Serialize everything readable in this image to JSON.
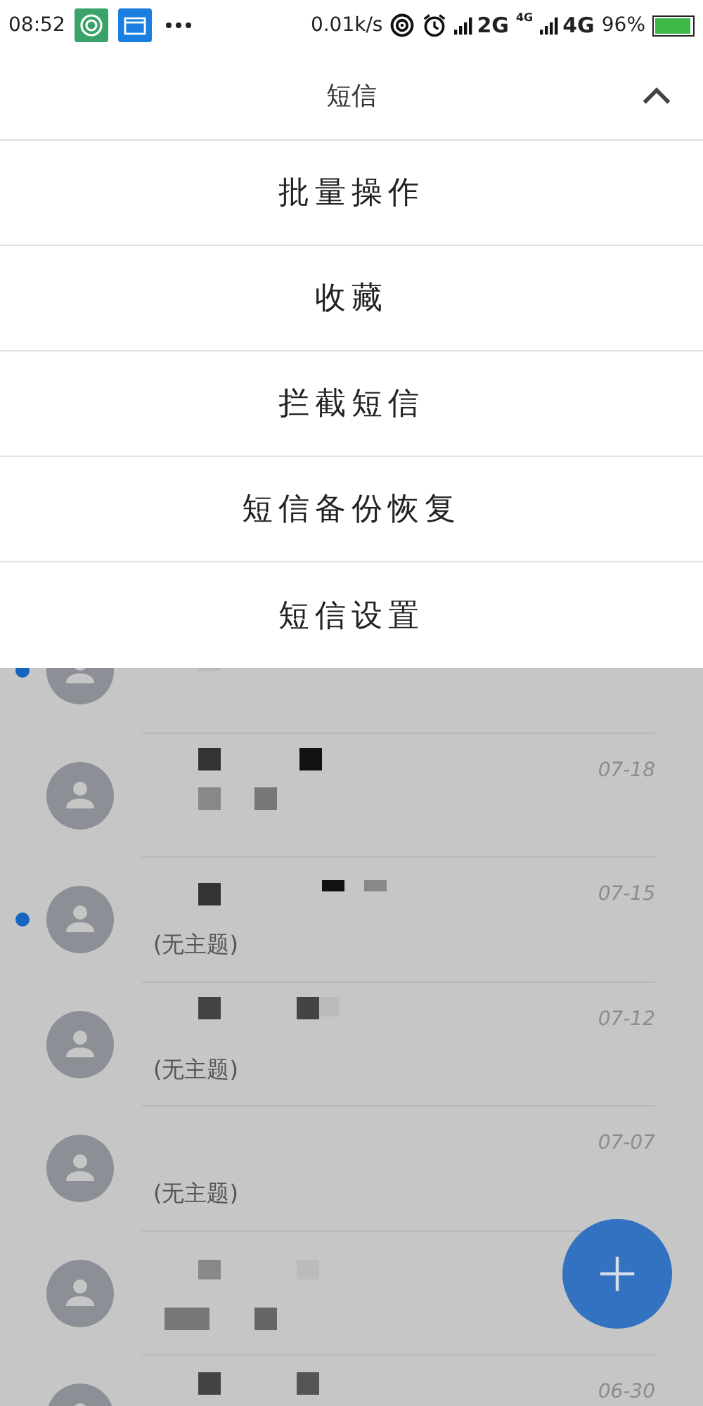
{
  "status_bar": {
    "time": "08:52",
    "speed": "0.01k/s",
    "sim1": "2G",
    "sim2_small": "4G",
    "sim2": "4G",
    "battery": "96%"
  },
  "header": {
    "title": "短信",
    "expanded": true
  },
  "menu": [
    {
      "label": "批量操作"
    },
    {
      "label": "收藏"
    },
    {
      "label": "拦截短信"
    },
    {
      "label": "短信备份恢复"
    },
    {
      "label": "短信设置"
    }
  ],
  "conversations": [
    {
      "unread": true
    },
    {
      "unread": false,
      "date": "07-18"
    },
    {
      "unread": true,
      "date": "07-15",
      "subject": "(无主题)"
    },
    {
      "unread": false,
      "date": "07-12",
      "subject": "(无主题)"
    },
    {
      "unread": false,
      "date": "07-07",
      "subject": "(无主题)"
    },
    {
      "unread": false
    },
    {
      "unread": false,
      "date": "06-30"
    }
  ]
}
